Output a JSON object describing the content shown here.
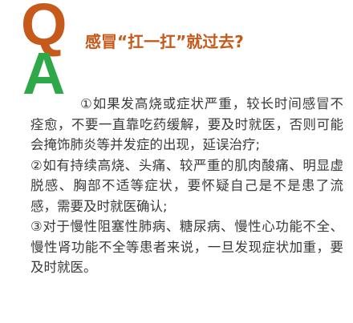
{
  "colors": {
    "q_letter": "#c55a1a",
    "a_letter": "#2fa84a",
    "question_text": "#c55a1a",
    "answer_text": "#3a3a3a"
  },
  "qa": {
    "q_letter": "Q",
    "a_letter": "A",
    "question": "感冒“扛一扛”就过去?",
    "answers": [
      "①如果发高烧或症状严重，较长时间感冒不痊愈，不要一直靠吃药缓解，要及时就医，否则可能会掩饰肺炎等并发症的出现，延误治疗;",
      "②如有持续高烧、头痛、较严重的肌肉酸痛、明显虚脱感、胸部不适等症状，要怀疑自己是不是患了流感，需要及时就医确认;",
      "③对于慢性阻塞性肺病、糖尿病、慢性心功能不全、慢性肾功能不全等患者来说，一旦发现症状加重，要及时就医。"
    ]
  }
}
